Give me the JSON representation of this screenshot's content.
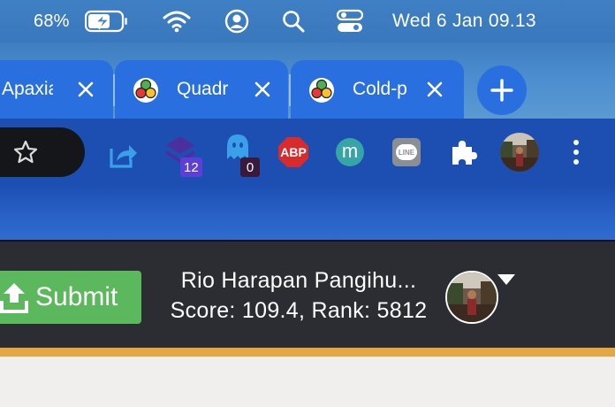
{
  "menubar": {
    "battery_percent": "68%",
    "clock": "Wed 6 Jan  09.13"
  },
  "tabs": [
    {
      "title": "Apaxia",
      "has_favicon": false
    },
    {
      "title": "Quadr",
      "has_favicon": true
    },
    {
      "title": "Cold-p",
      "has_favicon": true
    }
  ],
  "toolbar": {
    "extensions": [
      {
        "name": "share-extension-icon"
      },
      {
        "name": "stack-extension-icon",
        "badge": "12",
        "badge_color": "#5b3fd6"
      },
      {
        "name": "ghostery-icon",
        "badge": "0",
        "badge_color": "#3a1a3a"
      },
      {
        "name": "adblock-plus-icon",
        "label": "ABP"
      },
      {
        "name": "m-extension-icon",
        "label": "m"
      },
      {
        "name": "line-extension-icon",
        "label": "LINE"
      },
      {
        "name": "puzzle-extensions-icon"
      }
    ]
  },
  "header": {
    "submit_label": "Submit",
    "user_name": "Rio Harapan Pangihu...",
    "user_score": "Score: 109.4, Rank: 5812"
  },
  "colors": {
    "tab_active": "#2a6fe0",
    "toolbar": "#1d4fb3",
    "submit": "#5cb85c",
    "header_bg": "#2c2d32",
    "stripe": "#e6a641"
  }
}
